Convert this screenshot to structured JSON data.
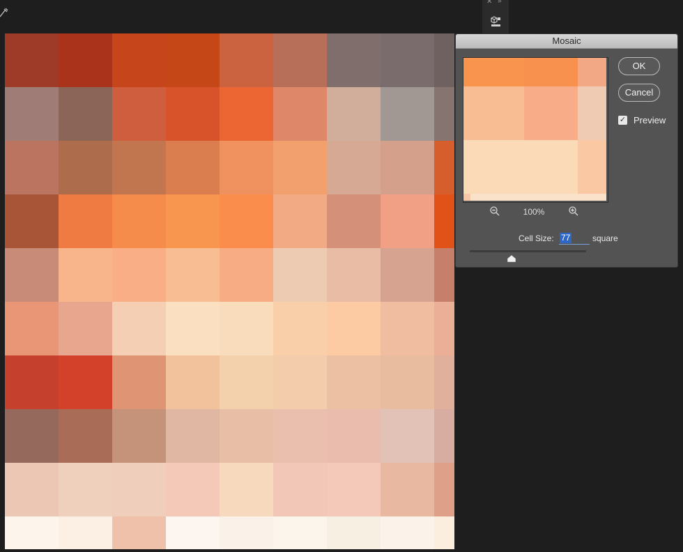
{
  "dialog": {
    "title": "Mosaic",
    "ok_label": "OK",
    "cancel_label": "Cancel",
    "preview_label": "Preview",
    "preview_checked": true,
    "zoom_level": "100%",
    "cell_size_label": "Cell Size:",
    "cell_size_value": "77",
    "cell_size_unit": "square",
    "cell_size_slider_fraction": 0.36,
    "preview_tiles": [
      [
        "#f9944f",
        "#f9944f",
        "#f7914d",
        "#f2a885"
      ],
      [
        "#f9bd94",
        "#f9bd94",
        "#f8ad88",
        "#efcbb3"
      ],
      [
        "#fbdab7",
        "#fbdab7",
        "#fbdab7",
        "#fac8a3"
      ],
      [
        "#f7c7a8",
        "#f9e2c9",
        "#f9e2c9",
        "#f9e2c9"
      ]
    ]
  },
  "icons": {
    "top_tool": "eyedropper-icon",
    "panel": "3d-panel-icon",
    "zoom_out": "zoom-out-icon",
    "zoom_in": "zoom-in-icon",
    "checkbox": "checkmark-icon",
    "close": "close-icon",
    "collapse": "collapse-chevrons-icon"
  },
  "colors": {
    "app_background": "#1e1e1e",
    "dialog_background": "#535353",
    "selection_blue": "#2f67c7"
  },
  "mosaic_tiles": [
    [
      "#9e3b28",
      "#a9341b",
      "#c6451a",
      "#c54616",
      "#cb6340",
      "#b86f5a",
      "#7f6e6c",
      "#7a6c6c",
      "#6f6160"
    ],
    [
      "#9f7c75",
      "#8b6558",
      "#cf5e3e",
      "#d9532a",
      "#eb6632",
      "#df8769",
      "#d1ad9b",
      "#a29893",
      "#857470"
    ],
    [
      "#bb7460",
      "#ad6d4c",
      "#c2764f",
      "#db7e4f",
      "#ef9260",
      "#f3a06f",
      "#d6a994",
      "#d4a08c",
      "#d55e2c"
    ],
    [
      "#a85537",
      "#f07b42",
      "#f58c4c",
      "#f8964f",
      "#fa8d4c",
      "#f2aa84",
      "#d49078",
      "#f1a086",
      "#e05217"
    ],
    [
      "#c88b78",
      "#f8b48b",
      "#faae86",
      "#f9bd94",
      "#f8ac83",
      "#edcbb2",
      "#e9bca5",
      "#d5a390",
      "#c57f6b"
    ],
    [
      "#e99676",
      "#e9a68f",
      "#f5cfb3",
      "#fadfc0",
      "#f8dcbb",
      "#f9cfaa",
      "#fccaa3",
      "#f0bda0",
      "#ebae97"
    ],
    [
      "#c5412e",
      "#d4412b",
      "#df9473",
      "#f2c29c",
      "#f3d1ad",
      "#f3ccac",
      "#ecc0a2",
      "#e8bc9f",
      "#e0b09d"
    ],
    [
      "#956a5c",
      "#a86c57",
      "#c49379",
      "#e0b7a2",
      "#e8bea6",
      "#ebbfad",
      "#e9bcad",
      "#e2c1b6",
      "#d7ada2"
    ],
    [
      "#ebc7b4",
      "#eed0bc",
      "#efcebc",
      "#f4c9b7",
      "#f7d9be",
      "#f3c7b7",
      "#f4c9b9",
      "#e8b9a0",
      "#dfa08a"
    ],
    [
      "#fdf4ec",
      "#fcefe4",
      "#f0c1aa",
      "#fdf6f0",
      "#faf1e9",
      "#fcf5ec",
      "#f7f0e2",
      "#fbf3e9",
      "#fceedf"
    ]
  ]
}
